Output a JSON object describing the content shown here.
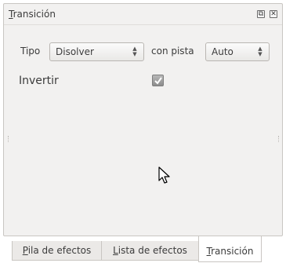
{
  "panel": {
    "title": "Transición",
    "title_mnemonic": "T",
    "title_rest": "ransición",
    "float_glyph": "⧉",
    "close_glyph": "✕"
  },
  "form": {
    "tipo_label": "Tipo",
    "tipo_value": "Disolver",
    "track_label": "con pista",
    "track_value": "Auto",
    "invert_label": "Invertir",
    "invert_checked": true
  },
  "tabs": [
    {
      "mnemonic": "P",
      "rest": "ila de efectos",
      "label": "Pila de efectos",
      "active": false
    },
    {
      "mnemonic": "L",
      "rest": "ista de efectos",
      "label": "Lista de efectos",
      "active": false
    },
    {
      "mnemonic": "T",
      "rest": "ransición",
      "label": "Transición",
      "active": true
    }
  ],
  "icons": {
    "float": "float-window-icon",
    "close": "close-icon",
    "cursor": "mouse-pointer-icon",
    "spinner": "spinner-arrows-icon"
  }
}
